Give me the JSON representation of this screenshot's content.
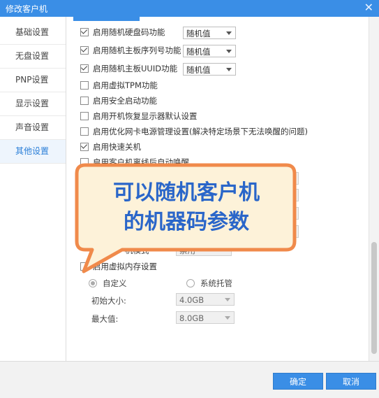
{
  "window": {
    "title": "修改客户机",
    "close_glyph": "✕"
  },
  "sidebar": {
    "items": [
      {
        "label": "基础设置"
      },
      {
        "label": "无盘设置"
      },
      {
        "label": "PNP设置"
      },
      {
        "label": "显示设置"
      },
      {
        "label": "声音设置"
      },
      {
        "label": "其他设置"
      }
    ],
    "active_index": 5
  },
  "options": [
    {
      "label": "启用随机硬盘码功能",
      "checked": true,
      "select": "随机值"
    },
    {
      "label": "启用随机主板序列号功能",
      "checked": true,
      "select": "随机值"
    },
    {
      "label": "启用随机主板UUID功能",
      "checked": true,
      "select": "随机值"
    },
    {
      "label": "启用虚拟TPM功能",
      "checked": false
    },
    {
      "label": "启用安全启动功能",
      "checked": false
    },
    {
      "label": "启用开机恢复显示器默认设置",
      "checked": false
    },
    {
      "label": "启用优化网卡电源管理设置(解决特定场景下无法唤醒的问题)",
      "checked": false
    },
    {
      "label": "启用快速关机",
      "checked": true
    },
    {
      "label": "启用客户机离线后自动唤醒",
      "checked": false
    }
  ],
  "partial": {
    "label_fragment": "机模式",
    "select_value": "禁用"
  },
  "virtual_memory": {
    "label": "启用虚拟内存设置",
    "checked": false,
    "mode_custom": "自定义",
    "mode_system": "系统托管",
    "initial_label": "初始大小:",
    "initial_value": "4.0GB",
    "max_label": "最大值:",
    "max_value": "8.0GB"
  },
  "callout": {
    "line1": "可以随机客户机",
    "line2": "的机器码参数",
    "fill": "#fdf2d9",
    "border": "#f08a4b",
    "text_color": "#2a66c9"
  },
  "footer": {
    "ok_label": "确定",
    "cancel_label": "取消"
  },
  "colors": {
    "accent": "#3a8ee6"
  }
}
